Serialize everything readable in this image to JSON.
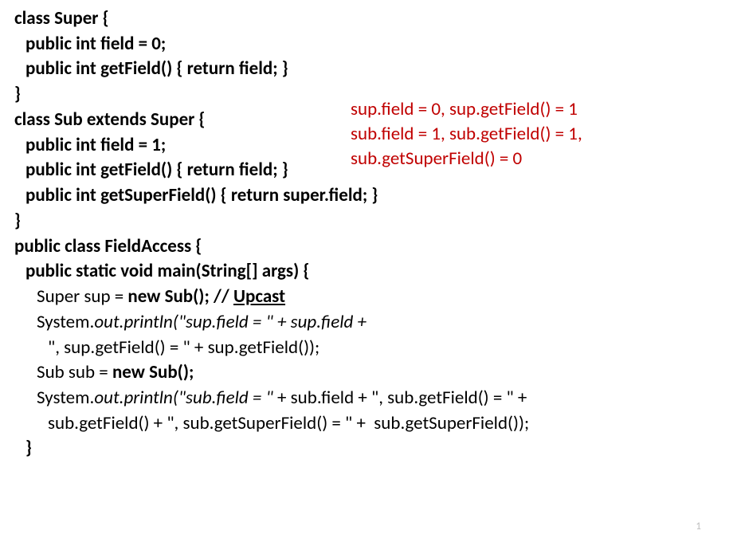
{
  "code": {
    "l1": "class Super {",
    "l2": "public int field = 0;",
    "l3": "public int getField() { return field; }",
    "l4": "}",
    "l5": "class Sub extends Super {",
    "l6": "public int field = 1;",
    "l7": "public int getField() { return field; }",
    "l8": "public int getSuperField() { return super.field; }",
    "l9": "}",
    "l10": "public class FieldAccess {",
    "l11": "public static void main(String[] args) {",
    "l12a": "Super sup = ",
    "l12b": "new Sub(); // ",
    "l12c": "Upcast",
    "l13a": "System.",
    "l13b": "out.println(\"sup.field = \" + sup.field +",
    "l14": "\", sup.getField() = \" + sup.getField());",
    "l15a": "Sub sub = ",
    "l15b": "new Sub();",
    "l16a": "System.",
    "l16b": "out.println(\"sub.field = \" ",
    "l16c": "+ sub.field + \", sub.getField() = \" +",
    "l17": "sub.getField() + \", sub.getSuperField() = \" +  sub.getSuperField());",
    "l18": "}"
  },
  "output": {
    "o1": "sup.field = 0, sup.getField() = 1",
    "o2": "sub.field = 1, sub.getField() = 1,",
    "o3": "sub.getSuperField() = 0"
  },
  "page_number": "1"
}
